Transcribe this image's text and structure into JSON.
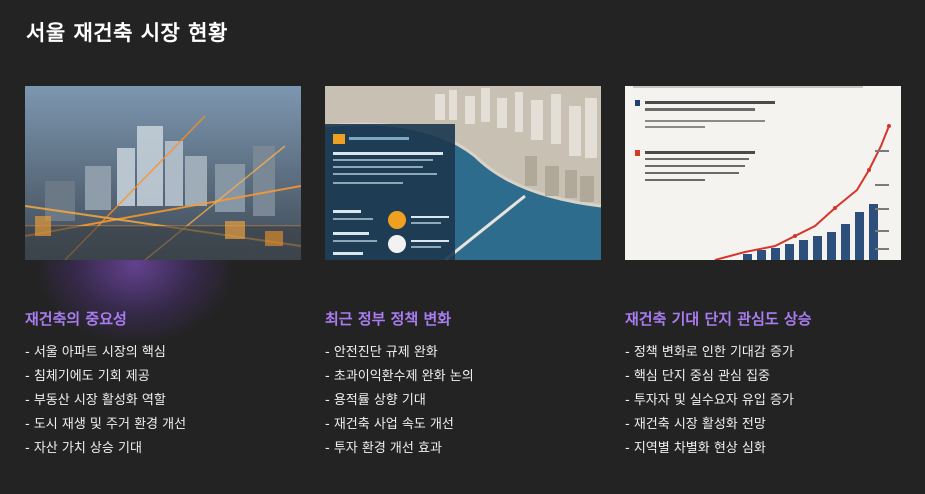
{
  "page": {
    "title": "서울 재건축 시장 현황"
  },
  "columns": [
    {
      "title": "재건축의 중요성",
      "image": "city-model-image",
      "bullets": [
        "- 서울 아파트 시장의 핵심",
        "- 침체기에도 기회 제공",
        "- 부동산 시장 활성화 역할",
        "- 도시 재생 및 주거 환경 개선",
        "- 자산 가치 상승 기대"
      ]
    },
    {
      "title": "최근 정부 정책 변화",
      "image": "riverside-infographic-image",
      "bullets": [
        "- 안전진단 규제 완화",
        "- 초과이익환수제 완화 논의",
        "- 용적률 상향 기대",
        "- 재건축 사업 속도 개선",
        "- 투자 환경 개선 효과"
      ]
    },
    {
      "title": "재건축 기대 단지 관심도 상승",
      "image": "growth-chart-image",
      "bullets": [
        "- 정책 변화로 인한 기대감 증가",
        "- 핵심 단지 중심 관심 집중",
        "- 투자자 및 실수요자 유입 증가",
        "- 재건축 시장 활성화 전망",
        "- 지역별 차별화 현상 심화"
      ]
    }
  ],
  "colors": {
    "accent": "#a97cf0",
    "background": "#232323",
    "text": "#f0f0f0"
  }
}
